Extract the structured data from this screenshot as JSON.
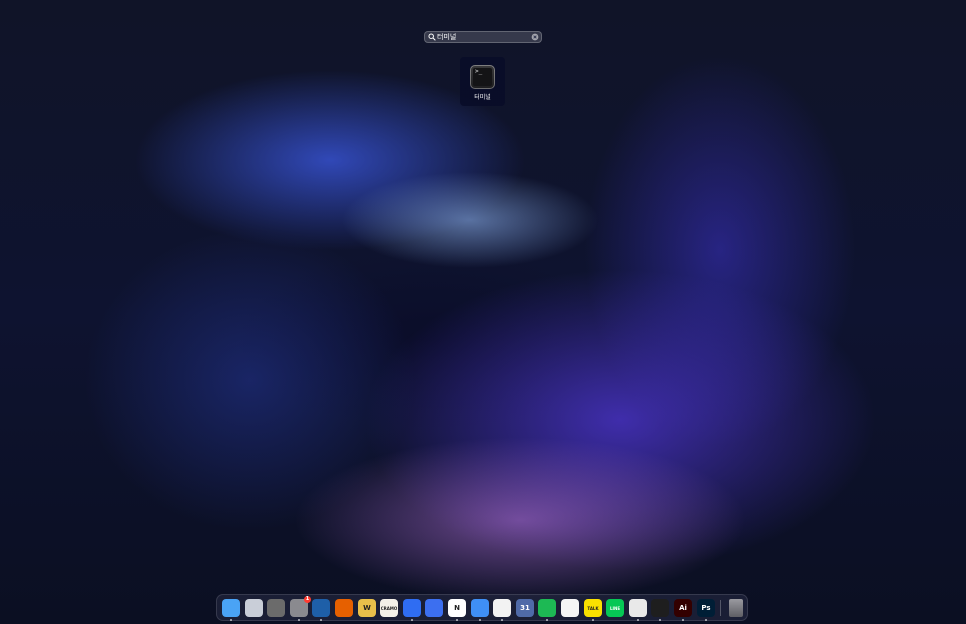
{
  "search": {
    "value": "터미널",
    "placeholder": ""
  },
  "results": [
    {
      "label": "터미널",
      "icon": "terminal-icon",
      "prompt": ">_"
    }
  ],
  "dock": {
    "apps": [
      {
        "id": "finder",
        "icon": "finder-icon",
        "label": "",
        "color": "#4aa3f5",
        "running": true
      },
      {
        "id": "launchpad",
        "icon": "launchpad-icon",
        "label": "",
        "color": "#c9ced8",
        "running": false
      },
      {
        "id": "calculator",
        "icon": "calculator-icon",
        "label": "",
        "color": "#6b6b6b",
        "running": false
      },
      {
        "id": "system-settings",
        "icon": "gear-icon",
        "label": "",
        "color": "#8a8a8f",
        "running": true,
        "badge": "1"
      },
      {
        "id": "twitter-client",
        "icon": "bird-icon",
        "label": "",
        "color": "#1e5fa8",
        "running": true
      },
      {
        "id": "firefox",
        "icon": "firefox-icon",
        "label": "",
        "color": "#e66000",
        "running": false
      },
      {
        "id": "notes-app",
        "icon": "w-icon",
        "label": "W",
        "color": "#e9c04a",
        "running": false
      },
      {
        "id": "cramo",
        "icon": "cramo-icon",
        "label": "CRAMO",
        "color": "#f4f1e8",
        "running": false
      },
      {
        "id": "cloud-app",
        "icon": "cloud-icon",
        "label": "",
        "color": "#2f6df2",
        "running": true
      },
      {
        "id": "pencil-app",
        "icon": "pencil-icon",
        "label": "",
        "color": "#3c6ff0",
        "running": false
      },
      {
        "id": "notion",
        "icon": "notion-icon",
        "label": "N",
        "color": "#ffffff",
        "running": true
      },
      {
        "id": "testflight",
        "icon": "triangle-icon",
        "label": "",
        "color": "#3f8ff5",
        "running": true
      },
      {
        "id": "things",
        "icon": "check-icon",
        "label": "",
        "color": "#f2f2f2",
        "running": true
      },
      {
        "id": "calendar-app",
        "icon": "calendar-icon",
        "label": "31",
        "color": "#4f6aa8",
        "running": false
      },
      {
        "id": "spotify",
        "icon": "spotify-icon",
        "label": "",
        "color": "#1db954",
        "running": true
      },
      {
        "id": "music-app",
        "icon": "music-icon",
        "label": "",
        "color": "#f5f5f5",
        "running": false
      },
      {
        "id": "kakaotalk",
        "icon": "kakaotalk-icon",
        "label": "TALK",
        "color": "#fae100",
        "running": true
      },
      {
        "id": "line",
        "icon": "line-icon",
        "label": "LINE",
        "color": "#06c755",
        "running": false
      },
      {
        "id": "powerpoint",
        "icon": "powerpoint-icon",
        "label": "",
        "color": "#e9e9e9",
        "running": true
      },
      {
        "id": "figma",
        "icon": "figma-icon",
        "label": "",
        "color": "#1e1e1e",
        "running": true
      },
      {
        "id": "illustrator",
        "icon": "illustrator-icon",
        "label": "Ai",
        "color": "#330000",
        "running": true
      },
      {
        "id": "photoshop",
        "icon": "photoshop-icon",
        "label": "Ps",
        "color": "#001e36",
        "running": true
      }
    ],
    "trash": {
      "id": "trash",
      "icon": "trash-icon",
      "label": "",
      "color": "#7a7a80"
    }
  },
  "colors": {
    "accent": "#3c6ff0",
    "search_text": "#ffffff"
  }
}
